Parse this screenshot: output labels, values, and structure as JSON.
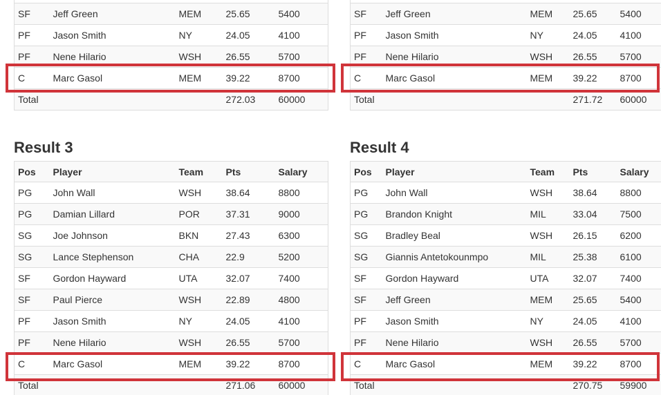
{
  "columns": [
    "Pos",
    "Player",
    "Team",
    "Pts",
    "Salary"
  ],
  "total_label": "Total",
  "highlight_color": "#d0343a",
  "results": [
    {
      "title": "",
      "rows": [
        {
          "pos": "",
          "player": "",
          "team": "",
          "pts": "",
          "salary": ""
        },
        {
          "pos": "SF",
          "player": "Jeff Green",
          "team": "MEM",
          "pts": "25.65",
          "salary": "5400"
        },
        {
          "pos": "PF",
          "player": "Jason Smith",
          "team": "NY",
          "pts": "24.05",
          "salary": "4100"
        },
        {
          "pos": "PF",
          "player": "Nene Hilario",
          "team": "WSH",
          "pts": "26.55",
          "salary": "5700"
        },
        {
          "pos": "C",
          "player": "Marc Gasol",
          "team": "MEM",
          "pts": "39.22",
          "salary": "8700"
        }
      ],
      "total_pts": "272.03",
      "total_salary": "60000"
    },
    {
      "title": "",
      "rows": [
        {
          "pos": "",
          "player": "",
          "team": "",
          "pts": "",
          "salary": ""
        },
        {
          "pos": "SF",
          "player": "Jeff Green",
          "team": "MEM",
          "pts": "25.65",
          "salary": "5400"
        },
        {
          "pos": "PF",
          "player": "Jason Smith",
          "team": "NY",
          "pts": "24.05",
          "salary": "4100"
        },
        {
          "pos": "PF",
          "player": "Nene Hilario",
          "team": "WSH",
          "pts": "26.55",
          "salary": "5700"
        },
        {
          "pos": "C",
          "player": "Marc Gasol",
          "team": "MEM",
          "pts": "39.22",
          "salary": "8700"
        }
      ],
      "total_pts": "271.72",
      "total_salary": "60000"
    },
    {
      "title": "Result 3",
      "rows": [
        {
          "pos": "PG",
          "player": "John Wall",
          "team": "WSH",
          "pts": "38.64",
          "salary": "8800"
        },
        {
          "pos": "PG",
          "player": "Damian Lillard",
          "team": "POR",
          "pts": "37.31",
          "salary": "9000"
        },
        {
          "pos": "SG",
          "player": "Joe Johnson",
          "team": "BKN",
          "pts": "27.43",
          "salary": "6300"
        },
        {
          "pos": "SG",
          "player": "Lance Stephenson",
          "team": "CHA",
          "pts": "22.9",
          "salary": "5200"
        },
        {
          "pos": "SF",
          "player": "Gordon Hayward",
          "team": "UTA",
          "pts": "32.07",
          "salary": "7400"
        },
        {
          "pos": "SF",
          "player": "Paul Pierce",
          "team": "WSH",
          "pts": "22.89",
          "salary": "4800"
        },
        {
          "pos": "PF",
          "player": "Jason Smith",
          "team": "NY",
          "pts": "24.05",
          "salary": "4100"
        },
        {
          "pos": "PF",
          "player": "Nene Hilario",
          "team": "WSH",
          "pts": "26.55",
          "salary": "5700"
        },
        {
          "pos": "C",
          "player": "Marc Gasol",
          "team": "MEM",
          "pts": "39.22",
          "salary": "8700"
        }
      ],
      "total_pts": "271.06",
      "total_salary": "60000"
    },
    {
      "title": "Result 4",
      "rows": [
        {
          "pos": "PG",
          "player": "John Wall",
          "team": "WSH",
          "pts": "38.64",
          "salary": "8800"
        },
        {
          "pos": "PG",
          "player": "Brandon Knight",
          "team": "MIL",
          "pts": "33.04",
          "salary": "7500"
        },
        {
          "pos": "SG",
          "player": "Bradley Beal",
          "team": "WSH",
          "pts": "26.15",
          "salary": "6200"
        },
        {
          "pos": "SG",
          "player": "Giannis Antetokounmpo",
          "team": "MIL",
          "pts": "25.38",
          "salary": "6100"
        },
        {
          "pos": "SF",
          "player": "Gordon Hayward",
          "team": "UTA",
          "pts": "32.07",
          "salary": "7400"
        },
        {
          "pos": "SF",
          "player": "Jeff Green",
          "team": "MEM",
          "pts": "25.65",
          "salary": "5400"
        },
        {
          "pos": "PF",
          "player": "Jason Smith",
          "team": "NY",
          "pts": "24.05",
          "salary": "4100"
        },
        {
          "pos": "PF",
          "player": "Nene Hilario",
          "team": "WSH",
          "pts": "26.55",
          "salary": "5700"
        },
        {
          "pos": "C",
          "player": "Marc Gasol",
          "team": "MEM",
          "pts": "39.22",
          "salary": "8700"
        }
      ],
      "total_pts": "270.75",
      "total_salary": "59900"
    }
  ]
}
